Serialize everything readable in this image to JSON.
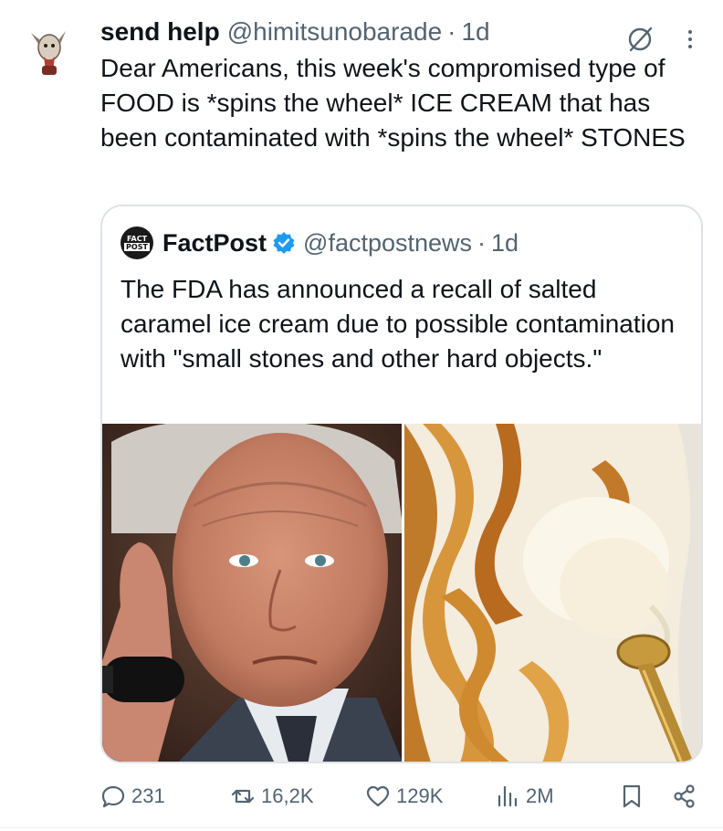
{
  "post": {
    "author_name": "send help",
    "author_handle": "@himitsunobarade",
    "separator": "·",
    "time": "1d",
    "text": "Dear Americans, this week's compromised type of FOOD is *spins the wheel* ICE CREAM that has been contaminated with *spins the wheel* STONES",
    "avatar_icon": "goat-avatar-icon",
    "grok_icon": "grok-icon",
    "more_icon": "more-dots-icon"
  },
  "quote": {
    "avatar_text_top": "FACT",
    "avatar_text_bottom": "POST",
    "author_name": "FactPost",
    "author_handle": "@factpostnews",
    "separator": "·",
    "time": "1d",
    "verified_icon": "verified-badge-icon",
    "verified_color": "#1d9bf0",
    "text": "The FDA has announced a recall of salted caramel ice cream due to possible contamination with \"small stones and other hard objects.\"",
    "media": [
      {
        "description_icon": "man-portrait-photo"
      },
      {
        "description_icon": "caramel-ice-cream-photo"
      }
    ]
  },
  "actions": {
    "replies": "231",
    "reposts": "16,2K",
    "likes": "129K",
    "views": "2M",
    "icons": [
      "reply-icon",
      "repost-icon",
      "like-icon",
      "views-icon",
      "bookmark-icon",
      "share-icon"
    ]
  },
  "colors": {
    "text": "#0f1419",
    "secondary": "#536471",
    "border": "#dfe3e6"
  }
}
